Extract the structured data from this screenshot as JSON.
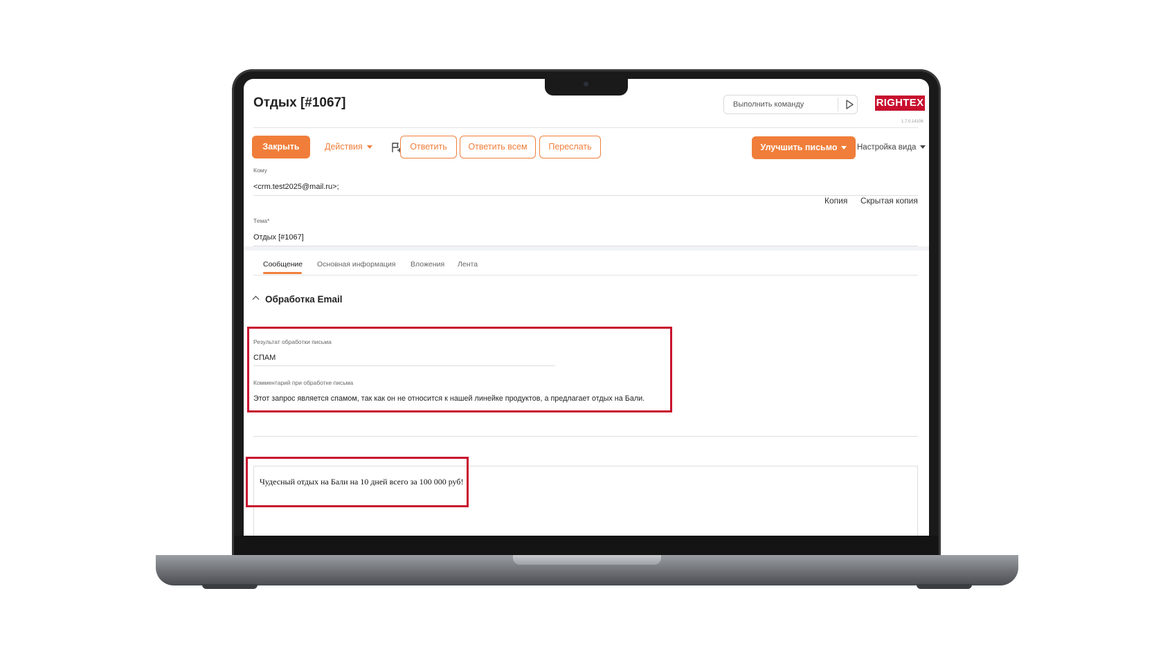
{
  "header": {
    "title": "Отдых [#1067]",
    "command_placeholder": "Выполнить команду",
    "brand": "RIGHTEX",
    "version": "1.7.0.14106"
  },
  "toolbar": {
    "close_label": "Закрыть",
    "actions_label": "Действия",
    "reply_label": "Ответить",
    "reply_all_label": "Ответить всем",
    "forward_label": "Переслать",
    "improve_label": "Улучшить письмо",
    "view_settings_label": "Настройка вида"
  },
  "form": {
    "to_label": "Кому",
    "to_value": "<crm.test2025@mail.ru>;",
    "cc_label": "Копия",
    "bcc_label": "Скрытая копия",
    "subject_label": "Тема*",
    "subject_value": "Отдых [#1067]"
  },
  "tabs": [
    {
      "label": "Сообщение",
      "active": true
    },
    {
      "label": "Основная информация",
      "active": false
    },
    {
      "label": "Вложения",
      "active": false
    },
    {
      "label": "Лента",
      "active": false
    }
  ],
  "processing": {
    "section_title": "Обработка Email",
    "result_label": "Результат обработки письма",
    "result_value": "СПАМ",
    "comment_label": "Комментарий при обработке письма",
    "comment_value": "Этот запрос является спамом, так как он не относится к нашей линейке продуктов, а предлагает отдых на Бали."
  },
  "letter": {
    "body": "Чудесный отдых на Бали на 10 дней всего за 100 000 руб!"
  },
  "colors": {
    "accent": "#f07e3a",
    "highlight": "#c8102e",
    "brand": "#c8102e"
  }
}
